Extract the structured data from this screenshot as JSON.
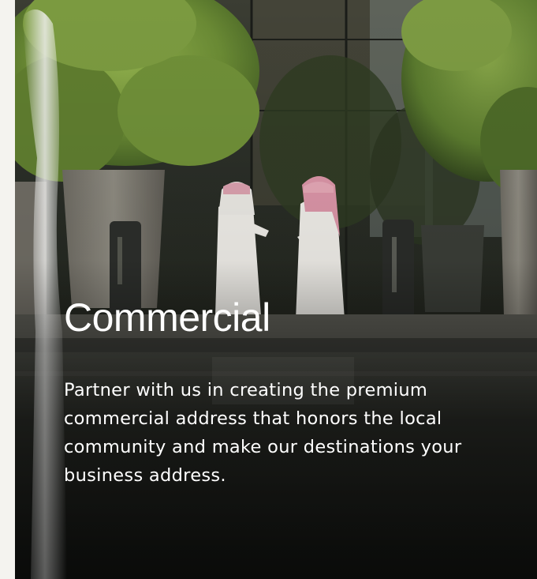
{
  "card": {
    "title": "Commercial",
    "description": "Partner with us in creating the premium commercial address that honors the local community and make our destinations your business address."
  },
  "colors": {
    "page_background": "#f4f3ef",
    "text": "#ffffff",
    "foliage": "#6f8a3a",
    "robe": "#e9e7e2",
    "headscarf": "#d99aa8"
  },
  "image": {
    "subject": "photo-two-men-in-thobes-talking-by-fountain"
  }
}
